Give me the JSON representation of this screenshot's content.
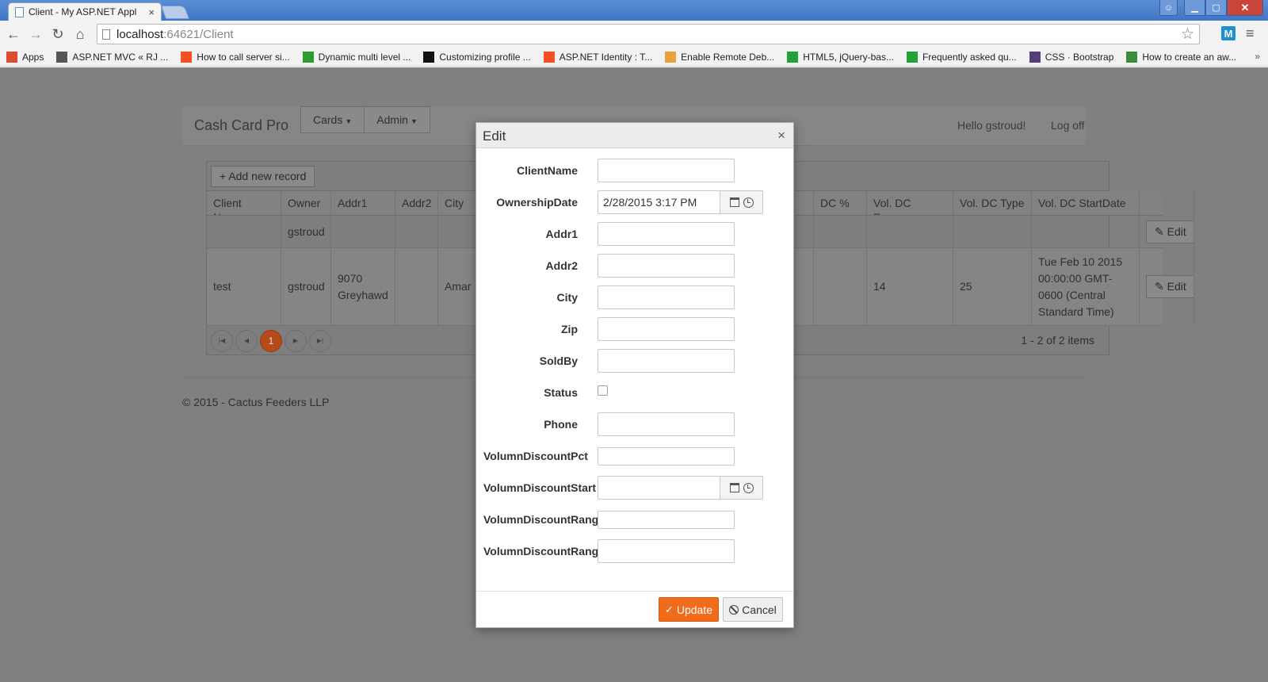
{
  "browser": {
    "tab_title": "Client - My ASP.NET Appl",
    "url_host": "localhost",
    "url_path": ":64621/Client",
    "bookmarks": [
      {
        "label": "Apps",
        "icon": "apps-grid-icon",
        "color": "#e04a2f"
      },
      {
        "label": "ASP.NET MVC « RJ ...",
        "icon": "gear-icon",
        "color": "#555555"
      },
      {
        "label": "How to call server si...",
        "icon": "windows-logo-icon",
        "color": "#f25022"
      },
      {
        "label": "Dynamic multi level ...",
        "icon": "green-square-icon",
        "color": "#2e9d2e"
      },
      {
        "label": "Customizing profile ...",
        "icon": "m-logo-icon",
        "color": "#111111"
      },
      {
        "label": "ASP.NET Identity : T...",
        "icon": "windows-logo-icon",
        "color": "#f25022"
      },
      {
        "label": "Enable Remote Deb...",
        "icon": "vs-logo-icon",
        "color": "#e8a33b"
      },
      {
        "label": "HTML5, jQuery-bas...",
        "icon": "green-arrows-icon",
        "color": "#23a23a"
      },
      {
        "label": "Frequently asked qu...",
        "icon": "green-arrows-icon",
        "color": "#23a23a"
      },
      {
        "label": "CSS · Bootstrap",
        "icon": "bootstrap-icon",
        "color": "#563d7c"
      },
      {
        "label": "How to create an aw...",
        "icon": "leaf-icon",
        "color": "#3b8d3b"
      }
    ]
  },
  "app": {
    "brand": "Cash Card Pro",
    "menu": [
      "Cards",
      "Admin"
    ],
    "greeting": "Hello gstroud!",
    "logoff": "Log off",
    "footer": "© 2015 - Cactus Feeders LLP"
  },
  "grid": {
    "add_label": "Add new record",
    "columns": [
      "Client Name",
      "Owner",
      "Addr1",
      "Addr2",
      "City",
      "DC %",
      "Vol. DC Range",
      "Vol. DC Type",
      "Vol. DC StartDate",
      ""
    ],
    "rows": [
      [
        "",
        "gstroud",
        "",
        "",
        "",
        "",
        "",
        "",
        "",
        "Edit"
      ],
      [
        "test",
        "gstroud",
        "9070 Greyhawd",
        "",
        "Amar",
        "",
        "14",
        "25",
        "Tue Feb 10 2015 00:00:00 GMT-0600 (Central Standard Time)",
        "Edit"
      ]
    ],
    "pager_current": "1",
    "pager_info": "1 - 2 of 2 items"
  },
  "modal": {
    "title": "Edit",
    "fields": [
      {
        "label": "ClientName",
        "type": "text",
        "value": ""
      },
      {
        "label": "OwnershipDate",
        "type": "datetime",
        "value": "2/28/2015 3:17 PM"
      },
      {
        "label": "Addr1",
        "type": "text",
        "value": ""
      },
      {
        "label": "Addr2",
        "type": "text",
        "value": ""
      },
      {
        "label": "City",
        "type": "text",
        "value": ""
      },
      {
        "label": "Zip",
        "type": "text",
        "value": ""
      },
      {
        "label": "SoldBy",
        "type": "text",
        "value": ""
      },
      {
        "label": "Status",
        "type": "checkbox",
        "value": ""
      },
      {
        "label": "Phone",
        "type": "text",
        "value": ""
      },
      {
        "label": "VolumnDiscountPct",
        "type": "short",
        "value": ""
      },
      {
        "label": "VolumnDiscountStart",
        "type": "datetime",
        "value": ""
      },
      {
        "label": "VolumnDiscountRange",
        "type": "short",
        "value": ""
      },
      {
        "label": "VolumnDiscountRange",
        "type": "text",
        "value": ""
      }
    ],
    "update_label": "Update",
    "cancel_label": "Cancel"
  },
  "colors": {
    "accent_orange": "#f06b1a",
    "pager_active": "#b8491a",
    "overlay_gray": "#808080"
  }
}
